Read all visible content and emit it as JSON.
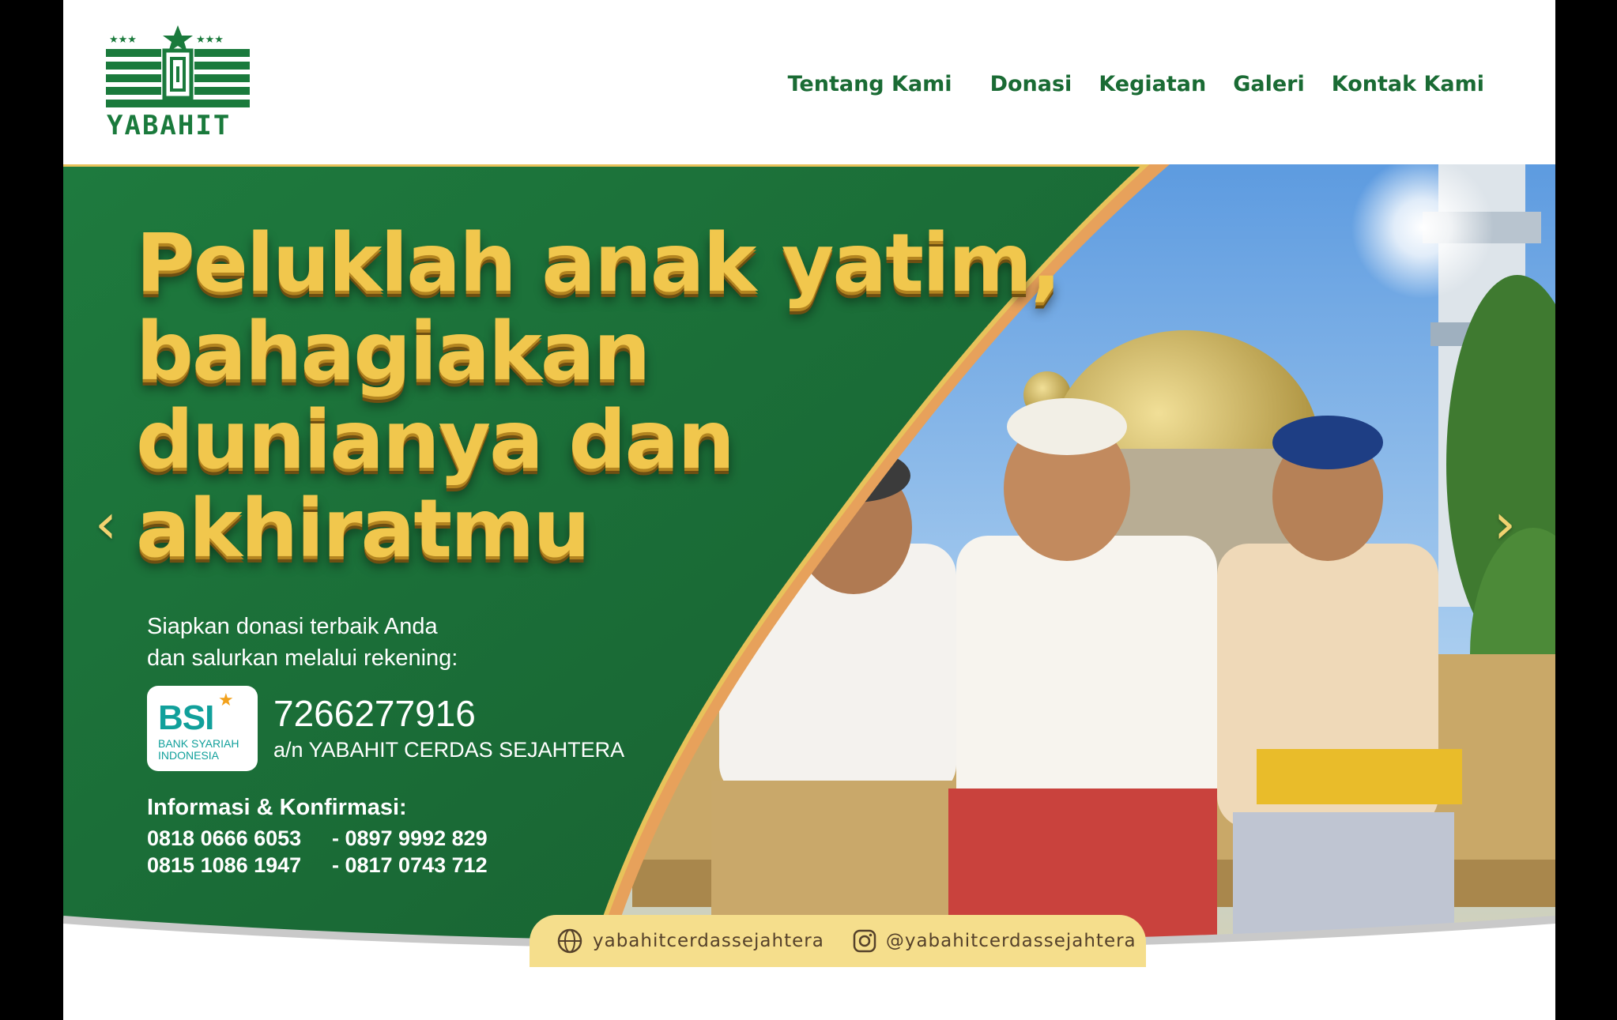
{
  "header": {
    "logo_text": "YABAHIT",
    "nav": [
      "Tentang Kami",
      "Donasi",
      "Kegiatan",
      "Galeri",
      "Kontak Kami"
    ]
  },
  "banner": {
    "headline": [
      "Peluklah anak yatim,",
      "bahagiakan",
      "dunianya dan",
      "akhiratmu"
    ],
    "subtitle": [
      "Siapkan donasi terbaik Anda",
      "dan salurkan melalui rekening:"
    ],
    "bank": {
      "logo": "BSI",
      "name_lines": [
        "BANK SYARIAH",
        "INDONESIA"
      ],
      "account_number": "7266277916",
      "account_name": "a/n YABAHIT CERDAS SEJAHTERA"
    },
    "info_title": "Informasi & Konfirmasi:",
    "phones": [
      [
        "0818 0666 6053",
        "- 0897 9992 829"
      ],
      [
        "0815 1086 1947",
        "- 0817 0743 712"
      ]
    ],
    "social": {
      "website": "yabahitcerdassejahtera",
      "instagram": "@yabahitcerdassejahtera"
    },
    "prev_arrow": "‹",
    "next_arrow": "›"
  },
  "colors": {
    "brand_green": "#1a6b34",
    "banner_green": "#1b6e37",
    "gold": "#f1c74d"
  }
}
